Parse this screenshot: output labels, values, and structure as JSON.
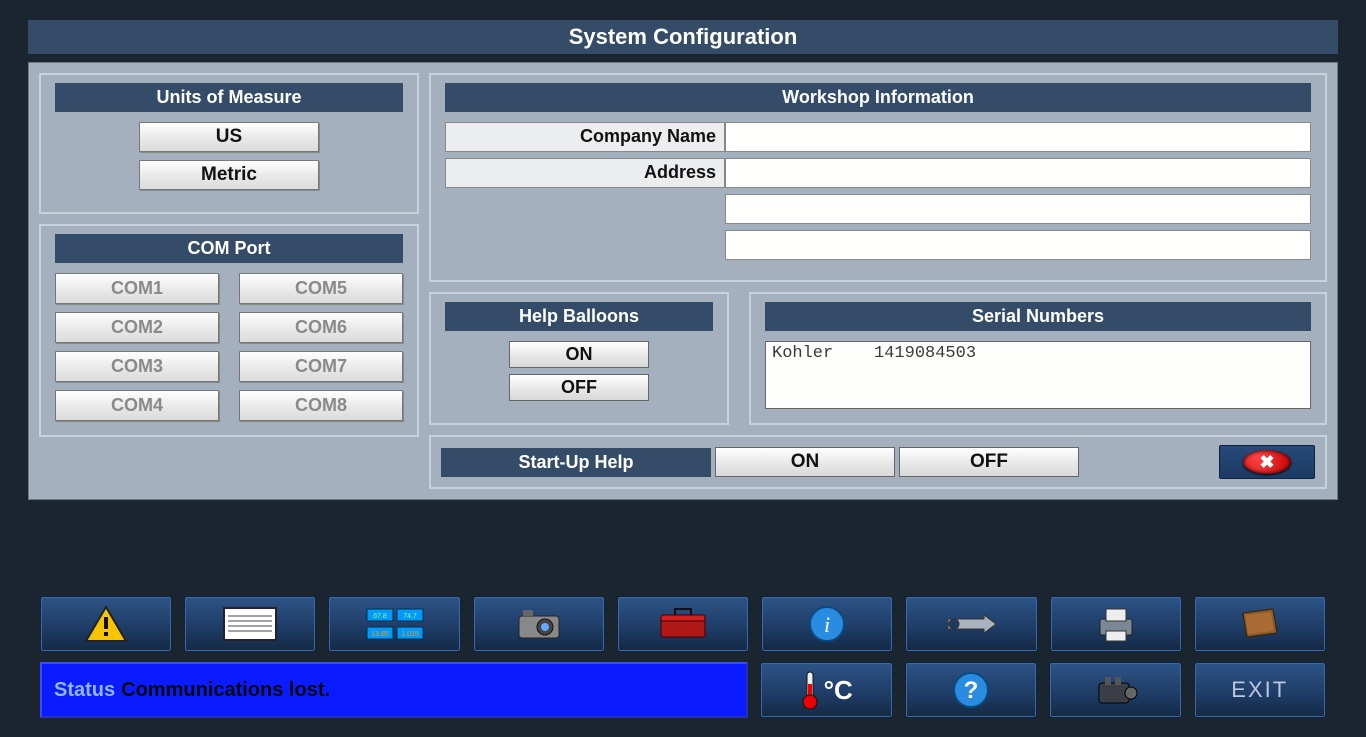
{
  "title": "System Configuration",
  "units_of_measure": {
    "header": "Units of Measure",
    "options": [
      "US",
      "Metric"
    ]
  },
  "com_port": {
    "header": "COM Port",
    "ports": [
      "COM1",
      "COM2",
      "COM3",
      "COM4",
      "COM5",
      "COM6",
      "COM7",
      "COM8"
    ]
  },
  "workshop": {
    "header": "Workshop Information",
    "labels": {
      "company": "Company Name",
      "address": "Address"
    },
    "company": "",
    "addr1": "",
    "addr2": "",
    "addr3": ""
  },
  "help_balloons": {
    "header": "Help Balloons",
    "on": "ON",
    "off": "OFF"
  },
  "serial_numbers": {
    "header": "Serial Numbers",
    "text": "Kohler    1419084503"
  },
  "startup_help": {
    "header": "Start-Up Help",
    "on": "ON",
    "off": "OFF"
  },
  "status": {
    "label": "Status",
    "text": "Communications lost."
  },
  "toolbar": {
    "exit_label": "EXIT",
    "temp_label": "°C"
  }
}
